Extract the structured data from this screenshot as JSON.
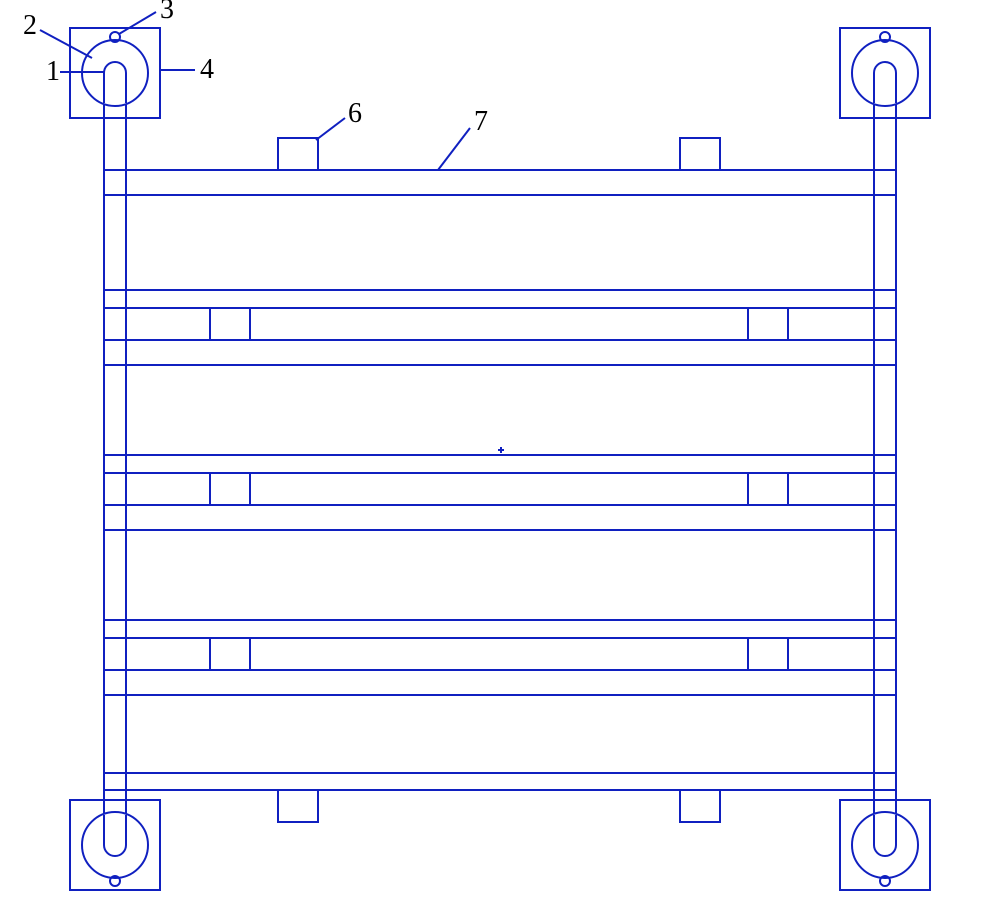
{
  "labels": {
    "l1": "1",
    "l2": "2",
    "l3": "3",
    "l4": "4",
    "l6": "6",
    "l7": "7"
  },
  "chart_data": {
    "type": "table",
    "description": "Mechanical engineering drawing — front view of a rectangular frame / rack structure with corner mounting pads and horizontal cross bars.",
    "parts": [
      {
        "ref": "1",
        "name": "U-slot of corner pad"
      },
      {
        "ref": "2",
        "name": "round boss on corner pad"
      },
      {
        "ref": "3",
        "name": "small pin on top of boss"
      },
      {
        "ref": "4",
        "name": "square mounting plate"
      },
      {
        "ref": "6",
        "name": "spacer block on top bar"
      },
      {
        "ref": "7",
        "name": "horizontal cross bar"
      }
    ],
    "corner_pads": 4,
    "horizontal_double_bars": 4,
    "spacer_pairs_between_bars": 4
  }
}
